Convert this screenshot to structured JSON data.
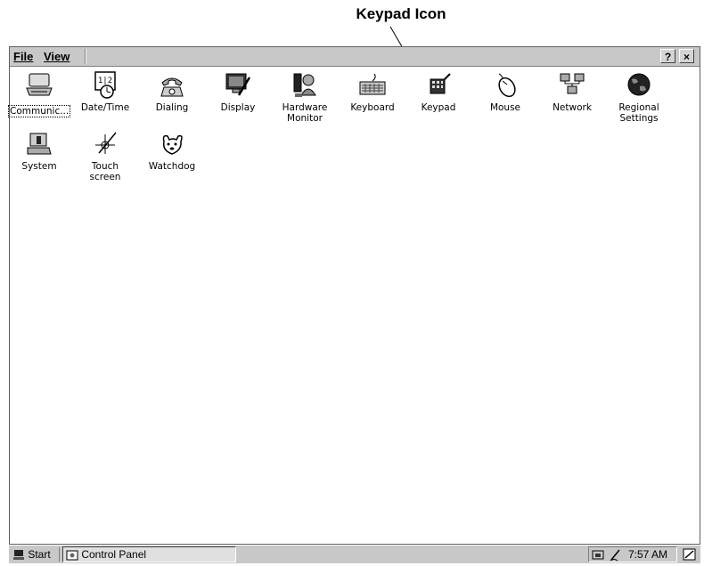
{
  "callout": {
    "text": "Keypad Icon"
  },
  "menubar": {
    "file_label": "File",
    "view_label": "View",
    "help_label": "?",
    "close_label": "×"
  },
  "icons": [
    {
      "label": "Communic...",
      "icon": "communications-icon"
    },
    {
      "label": "Date/Time",
      "icon": "calendar-clock-icon"
    },
    {
      "label": "Dialing",
      "icon": "telephone-icon"
    },
    {
      "label": "Display",
      "icon": "monitor-brush-icon"
    },
    {
      "label": "Hardware\nMonitor",
      "icon": "hardware-monitor-icon"
    },
    {
      "label": "Keyboard",
      "icon": "keyboard-icon"
    },
    {
      "label": "Keypad",
      "icon": "keypad-icon"
    },
    {
      "label": "Mouse",
      "icon": "mouse-icon"
    },
    {
      "label": "Network",
      "icon": "network-computers-icon"
    },
    {
      "label": "Regional\nSettings",
      "icon": "globe-icon"
    },
    {
      "label": "System",
      "icon": "system-computer-icon"
    },
    {
      "label": "Touch\nscreen",
      "icon": "touch-stylus-icon"
    },
    {
      "label": "Watchdog",
      "icon": "watchdog-icon"
    }
  ],
  "taskbar": {
    "start_label": "Start",
    "task_label": "Control Panel",
    "clock": "7:57 AM"
  }
}
